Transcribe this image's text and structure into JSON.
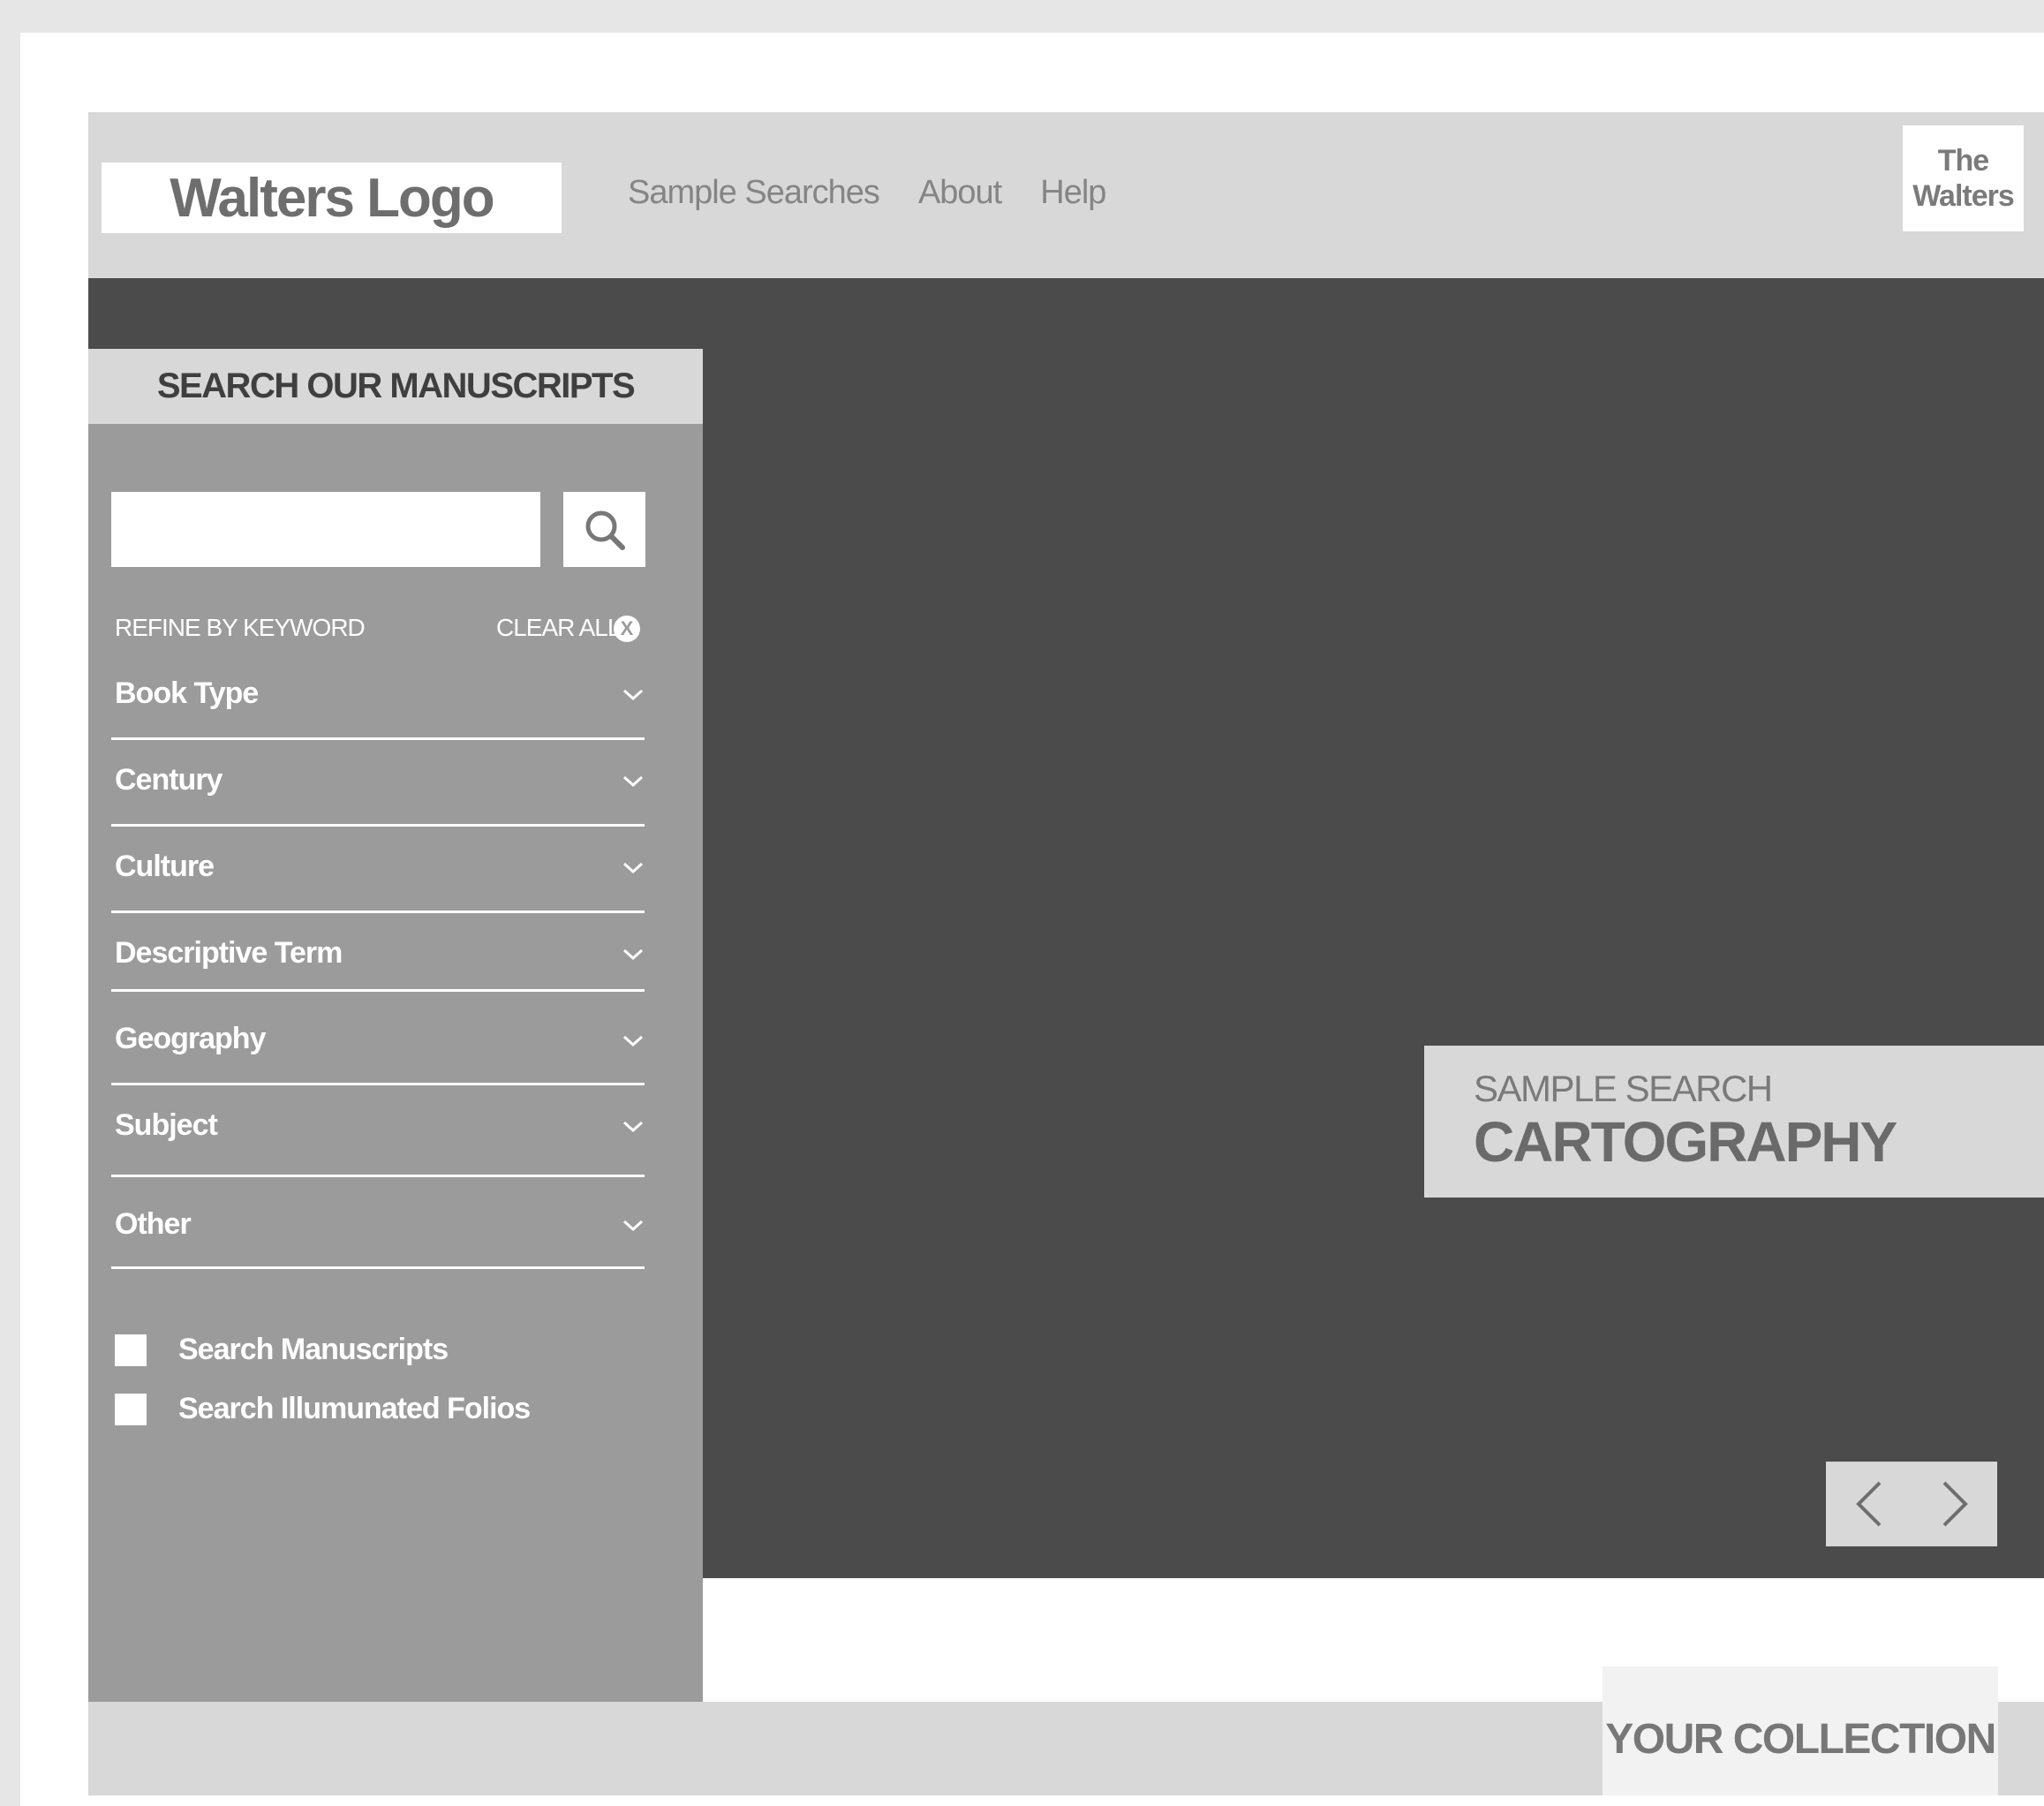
{
  "header": {
    "logo_text": "Walters Logo",
    "nav": [
      "Sample Searches",
      "About",
      "Help"
    ],
    "badge_line1": "The",
    "badge_line2": "Walters"
  },
  "search_panel": {
    "title": "SEARCH OUR MANUSCRIPTS",
    "input_value": "",
    "input_placeholder": "",
    "search_icon": "search-icon",
    "refine_label": "REFINE BY KEYWORD",
    "clear_all_label": "CLEAR ALL",
    "clear_icon_glyph": "X",
    "facets": [
      "Book Type",
      "Century",
      "Culture",
      "Descriptive Term",
      "Geography",
      "Subject",
      "Other"
    ],
    "checkboxes": [
      {
        "label": "Search Manuscripts",
        "checked": false
      },
      {
        "label": "Search Illumunated Folios",
        "checked": false
      }
    ]
  },
  "hero": {
    "sample_kicker": "SAMPLE SEARCH",
    "sample_title": "CARTOGRAPHY",
    "prev_icon": "chevron-left-icon",
    "next_icon": "chevron-right-icon"
  },
  "footer": {
    "collection_label": "YOUR COLLECTION"
  },
  "colors": {
    "page_bg": "#e6e6e6",
    "header_bg": "#d8d8d8",
    "hero_bg": "#4b4b4b",
    "panel_bg": "#9b9b9b",
    "text_light": "#ffffff",
    "text_muted": "#858585"
  }
}
